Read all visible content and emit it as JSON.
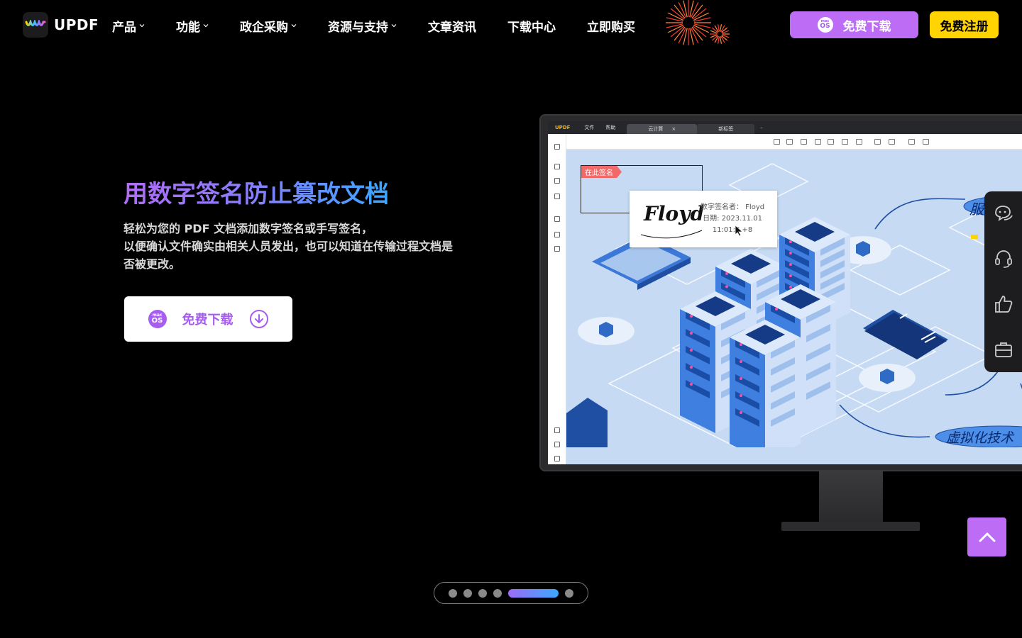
{
  "nav": {
    "logo_text": "UPDF",
    "menu": [
      {
        "label": "产品",
        "has_dropdown": true
      },
      {
        "label": "功能",
        "has_dropdown": true
      },
      {
        "label": "政企采购",
        "has_dropdown": true
      },
      {
        "label": "资源与支持",
        "has_dropdown": true
      },
      {
        "label": "文章资讯",
        "has_dropdown": false
      },
      {
        "label": "下载中心",
        "has_dropdown": false
      },
      {
        "label": "立即购买",
        "has_dropdown": false
      }
    ],
    "download_label": "免费下载",
    "register_label": "免费注册",
    "os_badge_top": "mac",
    "os_badge_bottom": "OS"
  },
  "hero": {
    "title": "用数字签名防止篡改文档",
    "desc_lines": [
      "轻松为您的 PDF 文档添加数字签名或手写签名，",
      "以便确认文件确实由相关人员发出，也可以知道在传输过程文档是",
      "否被更改。"
    ],
    "download_label": "免费下载",
    "os_badge_top": "mac",
    "os_badge_bottom": "OS"
  },
  "app_window": {
    "brand": "UPDF",
    "menu": [
      "文件",
      "帮助"
    ],
    "tabs": [
      {
        "label": "云计算",
        "active": true
      },
      {
        "label": "新标签",
        "active": false
      }
    ],
    "sign_here_tag": "在此签名",
    "signature_text": "Floyd",
    "signer_line": "数字签名者： Floyd",
    "date_line": "日期: 2023.11.01",
    "time_line": "11:01:0 +8",
    "callout_top": "服",
    "callout_bottom": "虚拟化技术"
  },
  "sidebar": {
    "items": [
      "chat-icon",
      "headset-icon",
      "thumbs-up-icon",
      "briefcase-icon"
    ]
  },
  "pager": {
    "count": 6,
    "active_index": 4
  },
  "colors": {
    "accent_purple": "#bd6cf5",
    "register_yellow": "#ffd400",
    "title_gradient": [
      "#b16cf5",
      "#3aa7ff"
    ]
  }
}
